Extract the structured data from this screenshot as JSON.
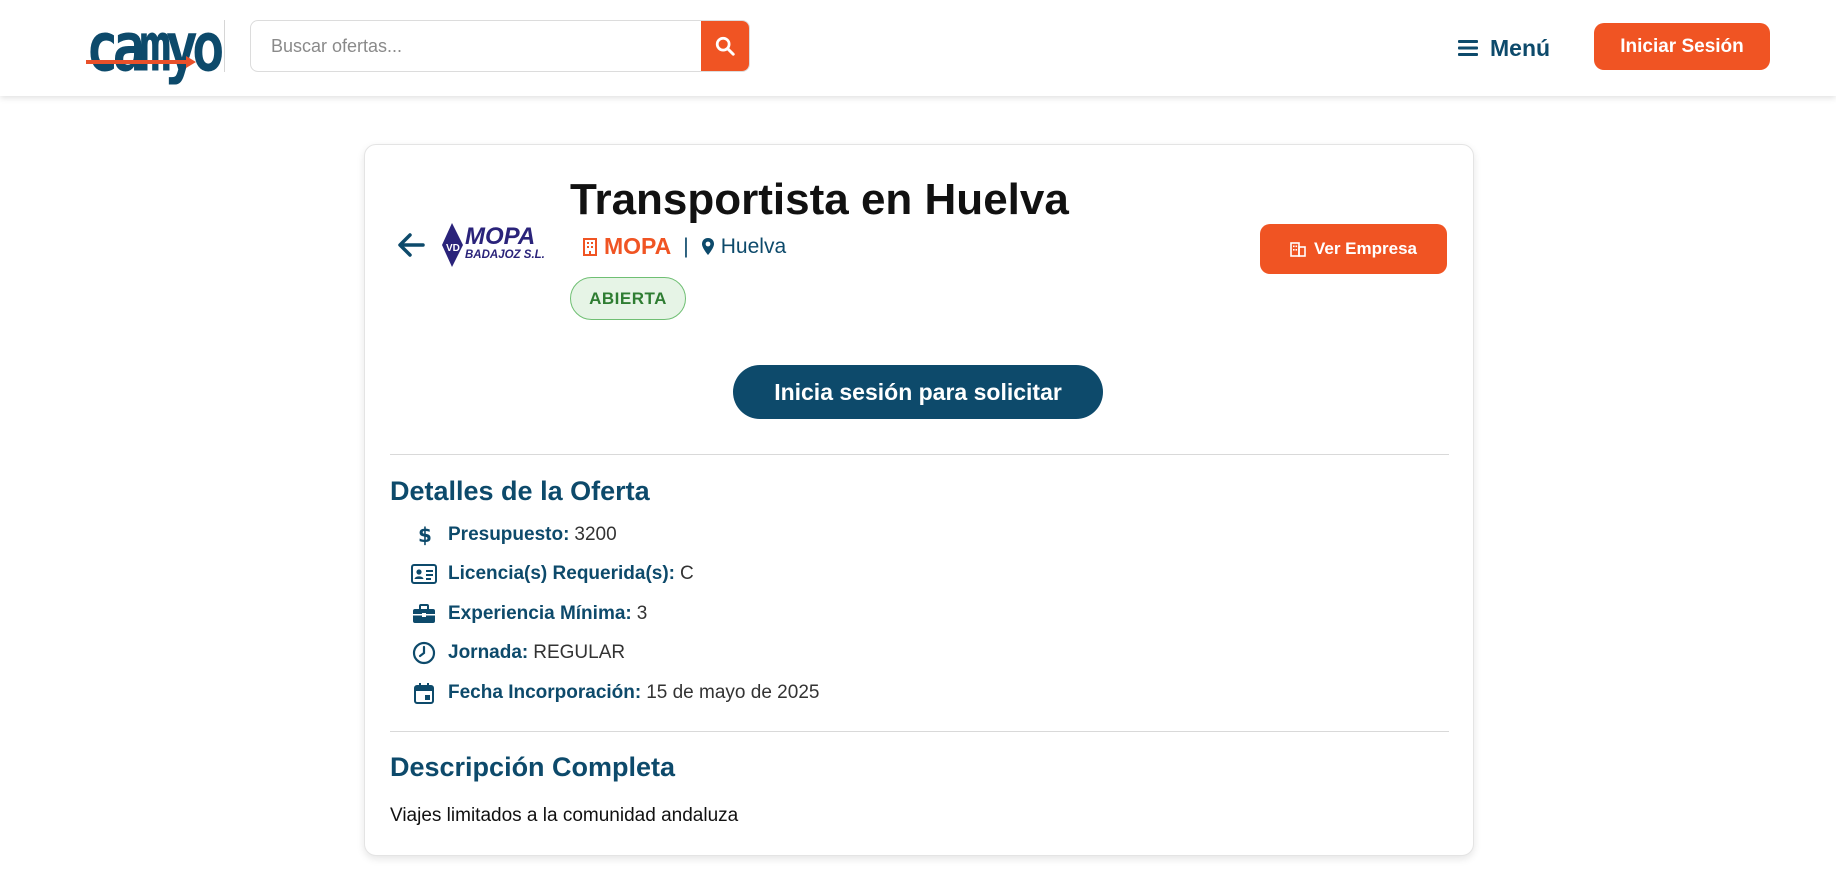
{
  "brand": {
    "logo_text": "camyo",
    "accent": "#f05423",
    "primary": "#0d4a6b"
  },
  "header": {
    "search_placeholder": "Buscar ofertas...",
    "menu_label": "Menú",
    "login_label": "Iniciar Sesión"
  },
  "job": {
    "title": "Transportista en Huelva",
    "company": "MOPA",
    "company_logo": {
      "line1": "MOPA",
      "line2": "BADAJOZ S.L."
    },
    "meta_separator": "|",
    "location": "Huelva",
    "status": "ABIERTA",
    "company_button": "Ver Empresa",
    "apply_button": "Inicia sesión para solicitar"
  },
  "details": {
    "title": "Detalles de la Oferta",
    "items": [
      {
        "icon": "dollar-icon",
        "label": "Presupuesto:",
        "value": "3200"
      },
      {
        "icon": "id-card-icon",
        "label": "Licencia(s) Requerida(s):",
        "value": "C"
      },
      {
        "icon": "briefcase-icon",
        "label": "Experiencia Mínima:",
        "value": "3"
      },
      {
        "icon": "clock-icon",
        "label": "Jornada:",
        "value": "REGULAR"
      },
      {
        "icon": "calendar-icon",
        "label": "Fecha Incorporación:",
        "value": "15 de mayo de 2025"
      }
    ]
  },
  "description": {
    "title": "Descripción Completa",
    "text": "Viajes limitados a la comunidad andaluza"
  }
}
